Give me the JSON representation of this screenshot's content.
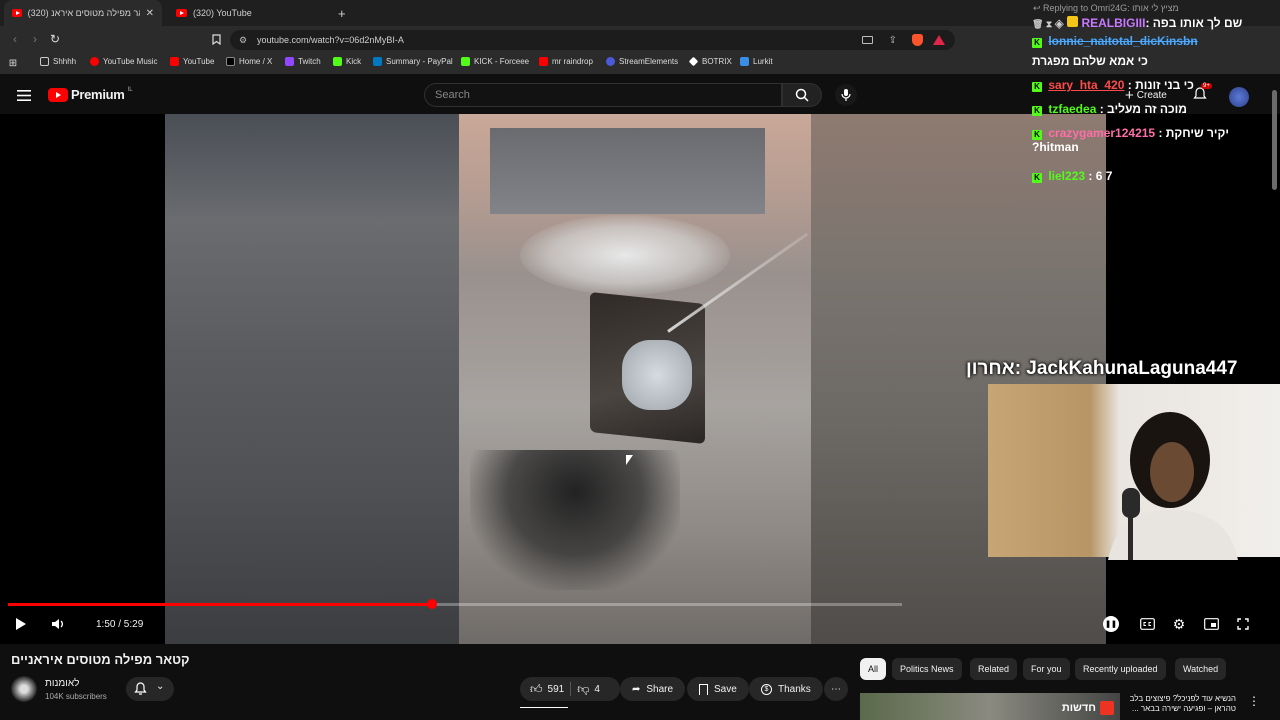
{
  "browser": {
    "tabs": [
      {
        "label": "(320) קטאר מפילה מטוסים איראנ",
        "active": true
      },
      {
        "label": "(320) YouTube",
        "active": false
      }
    ],
    "new_tab": "+",
    "url": "youtube.com/watch?v=06d2nMyBI-A",
    "bookmarks": [
      "Shhhh",
      "YouTube Music",
      "YouTube",
      "Home / X",
      "Twitch",
      "Kick",
      "Summary - PayPal",
      "KICK - Forceee",
      "mr raindrop",
      "StreamElements",
      "BOTRIX",
      "Lurkit"
    ]
  },
  "youtube": {
    "logo": "Premium",
    "logo_region": "IL",
    "search_placeholder": "Search",
    "create_label": "Create",
    "notif_count": "9+"
  },
  "stream_overlay": {
    "reply_header": "Replying to Omri24G: מציץ לי אותו",
    "chat": [
      {
        "user": "REALBIGIII",
        "text": "שם לך אותו בפה",
        "color": "#c879ff"
      },
      {
        "user": "lonnie_naitotal_dicKinsbn",
        "text": "כי אמא שלהם מפגרת",
        "color": "#4aa8ff"
      },
      {
        "user": "sary_hta_420",
        "text": "כי בני זונות",
        "color": "#ff4a4a"
      },
      {
        "user": "tzfaedea",
        "text": "מוכה זה מעליב",
        "color": "#53fc18"
      },
      {
        "user": "crazygamer124215",
        "text": "יקיר שיחקת hitman?",
        "color": "#ff6ea8"
      },
      {
        "user": "liel223",
        "text": "6 7",
        "color": "#53fc18"
      }
    ],
    "last_label": "אחרון: JackKahunaLaguna447"
  },
  "player": {
    "time": "1:50 / 5:29",
    "progress": 0.474
  },
  "video": {
    "title": "קטאר מפילה מטוסים איראניים",
    "channel": "לאומנות",
    "subscribers": "104K subscribers",
    "likes": "591",
    "dislikes": "4",
    "share": "Share",
    "save": "Save",
    "thanks": "Thanks",
    "more": "⋯"
  },
  "chips": [
    "All",
    "Politics News",
    "Related",
    "For you",
    "Recently uploaded",
    "Watched"
  ],
  "recommendation": {
    "title": "הנשיא עוד לפניכל? פיצוצים בלב טהראן – ופגיעה ישירה בבאר ...",
    "thumb_text": "חדשות"
  },
  "colors": {
    "accent": "#ff0000",
    "kick": "#53fc18"
  }
}
